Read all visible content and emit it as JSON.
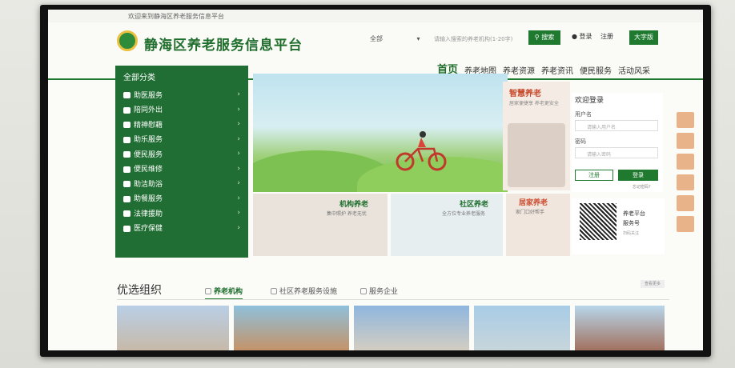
{
  "topbar": {
    "welcome": "欢迎来到静海区养老服务信息平台"
  },
  "header": {
    "title": "静海区养老服务信息平台",
    "search_select": "全部",
    "search_placeholder": "请输入搜索的养老机构(1-20字)",
    "search_button": "搜索",
    "login": "登录",
    "register": "注册",
    "big_font": "大字版"
  },
  "nav": {
    "items": [
      "首页",
      "养老地图",
      "养老资源",
      "养老资讯",
      "便民服务",
      "活动风采"
    ]
  },
  "categories": {
    "title": "全部分类",
    "items": [
      "助医服务",
      "陪同外出",
      "精神慰藉",
      "助乐服务",
      "便民服务",
      "便民维修",
      "助洁助浴",
      "助餐服务",
      "法律援助",
      "医疗保健"
    ]
  },
  "smart": {
    "title": "智慧养老",
    "subtitle": "居家便捷享 养老更安全"
  },
  "login_box": {
    "title": "欢迎登录",
    "username_label": "用户名",
    "username_placeholder": "请输入用户名",
    "password_label": "密码",
    "password_placeholder": "请输入密码",
    "register": "注册",
    "submit": "登录",
    "forgot": "忘记密码?"
  },
  "services": [
    {
      "title": "机构养老",
      "subtitle": "集中照护 养老无忧"
    },
    {
      "title": "社区养老",
      "subtitle": "全方位专业养老服务"
    },
    {
      "title": "居家养老",
      "subtitle": "家门口好帮手"
    }
  ],
  "qr": {
    "line1": "养老平台",
    "line2": "服务号",
    "line3": "扫码关注"
  },
  "featured": {
    "title": "优选组织",
    "tabs": [
      "养老机构",
      "社区养老服务设施",
      "服务企业"
    ],
    "more": "查看更多"
  },
  "colors": {
    "brand_green": "#1f7a30",
    "accent_orange": "#c94a2c"
  }
}
